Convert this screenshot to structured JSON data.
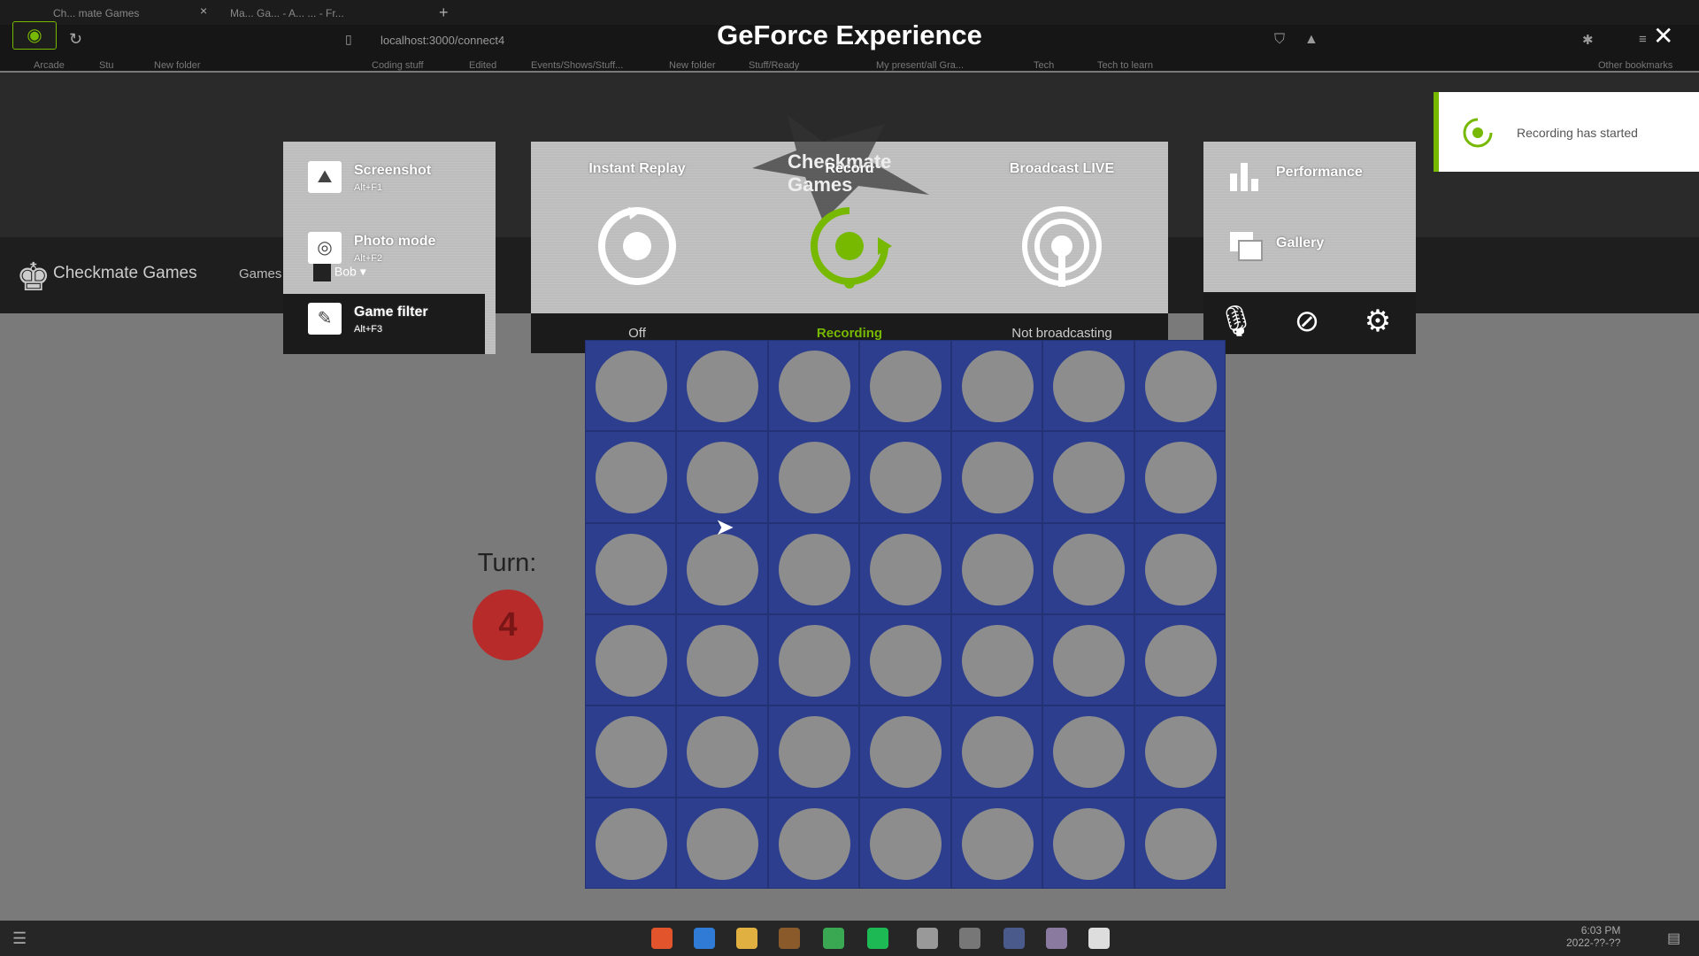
{
  "browser": {
    "tabs": [
      {
        "label": "Ch... mate Games"
      },
      {
        "label": "Ma... Ga... - A... ... - Fr..."
      }
    ],
    "address": "localhost:3000/connect4",
    "bookmarks": [
      "Arcade",
      "Stu",
      "New folder",
      "Coding stuff",
      "Edited",
      "Events/Shows/Stuff...",
      "New folder",
      "Stuff/Ready",
      "My present/all Gra...",
      "Tech",
      "Tech to learn",
      "Other bookmarks"
    ]
  },
  "overlay": {
    "title": "GeForce Experience",
    "left_panel": [
      {
        "label": "Screenshot",
        "shortcut": "Alt+F1",
        "icon": "image-icon"
      },
      {
        "label": "Photo mode",
        "shortcut": "Alt+F2",
        "icon": "camera-icon"
      },
      {
        "label": "Game filter",
        "shortcut": "Alt+F3",
        "icon": "filter-brush-icon"
      }
    ],
    "modes": [
      {
        "label": "Instant Replay",
        "status": "Off",
        "icon": "instant-replay-icon"
      },
      {
        "label": "Record",
        "status": "Recording",
        "icon": "record-icon"
      },
      {
        "label": "Broadcast LIVE",
        "status": "Not broadcasting",
        "icon": "broadcast-icon"
      }
    ],
    "right_panel": [
      {
        "label": "Performance",
        "icon": "bar-chart-icon"
      },
      {
        "label": "Gallery",
        "icon": "gallery-icon"
      }
    ],
    "bottom_icons": [
      "microphone-icon",
      "camera-off-icon",
      "settings-icon"
    ],
    "toast": "Recording has started",
    "accent_color": "#76b900"
  },
  "app": {
    "brand": "Checkmate Games",
    "watermark": "Checkmate Games",
    "nav_games": "Games",
    "user": "Bob",
    "turn_label": "Turn:",
    "turn_chip": "4",
    "board": {
      "columns": 7,
      "rows": 6
    }
  },
  "taskbar": {
    "time": "6:03 PM",
    "date": "2022-??-??"
  }
}
